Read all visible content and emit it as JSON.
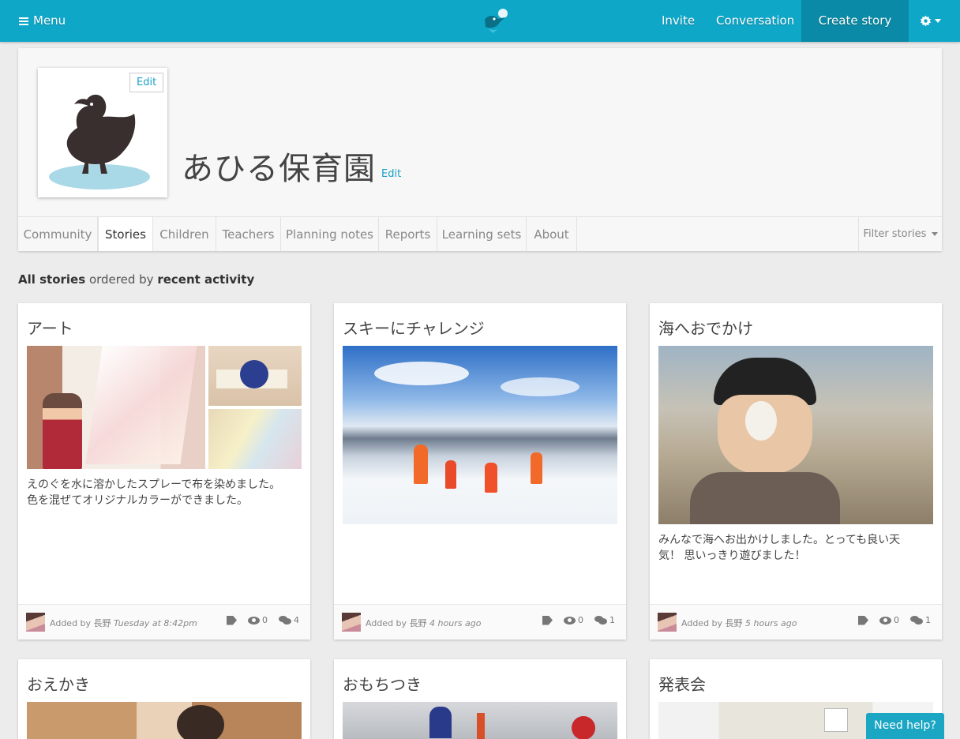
{
  "topbar": {
    "menu_label": "Menu",
    "nav": {
      "invite": "Invite",
      "conversation": "Conversation",
      "create_story": "Create story"
    },
    "brand_color": "#0fa7c8"
  },
  "header": {
    "org_name": "あひる保育園",
    "avatar_edit": "Edit",
    "name_edit": "Edit"
  },
  "tabs": [
    "Community",
    "Stories",
    "Children",
    "Teachers",
    "Planning notes",
    "Reports",
    "Learning sets",
    "About"
  ],
  "active_tab": "Stories",
  "filter_label": "Filter stories",
  "order": {
    "scope": "All stories",
    "middle": "ordered by",
    "sort": "recent activity"
  },
  "stories": [
    {
      "title": "アート",
      "text_line1": "えのぐを水に溶かしたスプレーで布を染めました。",
      "text_line2": "色を混ぜてオリジナルカラーができました。",
      "added_by": "Added by",
      "author": "長野",
      "when": "Tuesday at 8:42pm",
      "views": "0",
      "comments": "4"
    },
    {
      "title": "スキーにチャレンジ",
      "text_line1": "",
      "text_line2": "",
      "added_by": "Added by",
      "author": "長野",
      "when": "4 hours ago",
      "views": "0",
      "comments": "1"
    },
    {
      "title": "海へおでかけ",
      "text_line1": "みんなで海へお出かけしました。とっても良い天",
      "text_line2": "気！ 思いっきり遊びました！",
      "added_by": "Added by",
      "author": "長野",
      "when": "5 hours ago",
      "views": "0",
      "comments": "1"
    },
    {
      "title": "おえかき"
    },
    {
      "title": "おもちつき"
    },
    {
      "title": "発表会"
    }
  ],
  "help_label": "Need help?"
}
